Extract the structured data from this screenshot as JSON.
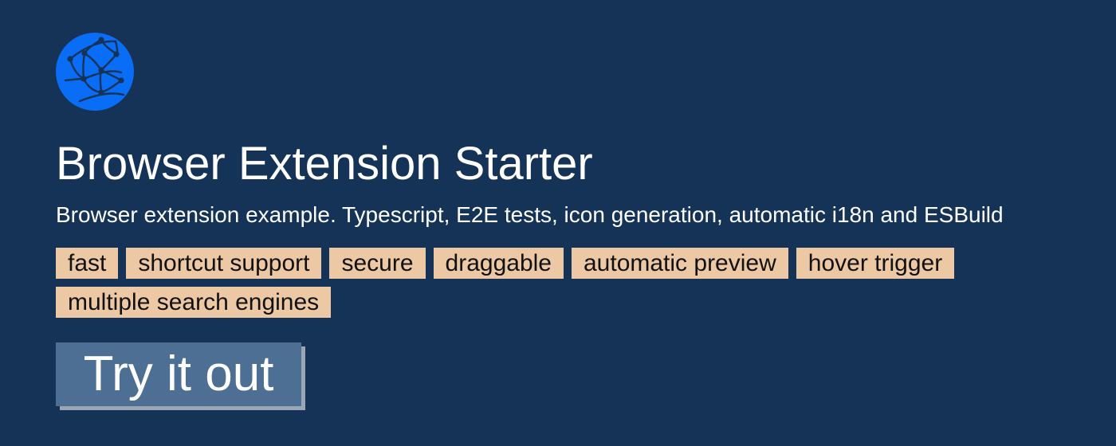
{
  "logo": {
    "icon": "globe-network-icon",
    "color": "#0a6df5"
  },
  "title": "Browser Extension Starter",
  "subtitle": "Browser extension example. Typescript, E2E tests, icon generation, automatic i18n and ESBuild",
  "tags": [
    "fast",
    "shortcut support",
    "secure",
    "draggable",
    "automatic preview",
    "hover trigger",
    "multiple search engines"
  ],
  "cta": {
    "label": "Try it out"
  },
  "colors": {
    "background": "#143357",
    "tag_background": "#edc8a5",
    "button_background": "#4d6f93",
    "button_shadow": "#9aa6b4"
  }
}
